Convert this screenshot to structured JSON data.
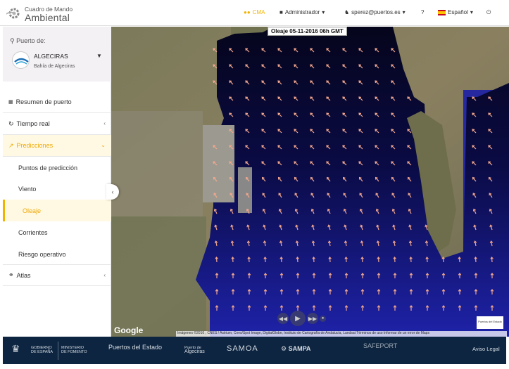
{
  "app": {
    "logo_line1": "Cuadro de Mando",
    "logo_line2": "Ambiental"
  },
  "header": {
    "cma_label": "CMA",
    "admin_label": "Administrador",
    "user_label": "sperez@puertos.es",
    "help_label": "?",
    "lang_label": "Español",
    "accent_color": "#f0b400"
  },
  "sidebar": {
    "port_label": "Puerto de:",
    "port_name": "ALGECIRAS",
    "port_sub": "Bahía de Algeciras",
    "items": [
      {
        "label": "Resumen de puerto"
      },
      {
        "label": "Tiempo real"
      },
      {
        "label": "Predicciones"
      },
      {
        "label": "Atlas"
      }
    ],
    "sub_items": [
      {
        "label": "Puntos de predicción"
      },
      {
        "label": "Viento"
      },
      {
        "label": "Oleaje"
      },
      {
        "label": "Corrientes"
      },
      {
        "label": "Riesgo operativo"
      }
    ]
  },
  "map": {
    "title": "Oleaje 05-11-2016 06h GMT",
    "google_label": "Google",
    "attribution": "Imágenes ©2016 , CNES / Astrium, Cnes/Spot Image, DigitalGlobe, Instituto de Cartografía de Andalucía, Landsat   Términos de uso   Informar de un error de Maps",
    "badge": "Puertos del Estado"
  },
  "footer": {
    "gov1": "GOBIERNO",
    "gov2": "DE ESPAÑA",
    "min1": "MINISTERIO",
    "min2": "DE FOMENTO",
    "puertos": "Puertos del Estado",
    "algeciras1": "Puerto de",
    "algeciras2": "Algeciras",
    "samoa": "SAMOA",
    "sampa": "SAMPA",
    "safeport": "SAFEPORT",
    "aviso": "Aviso Legal"
  }
}
